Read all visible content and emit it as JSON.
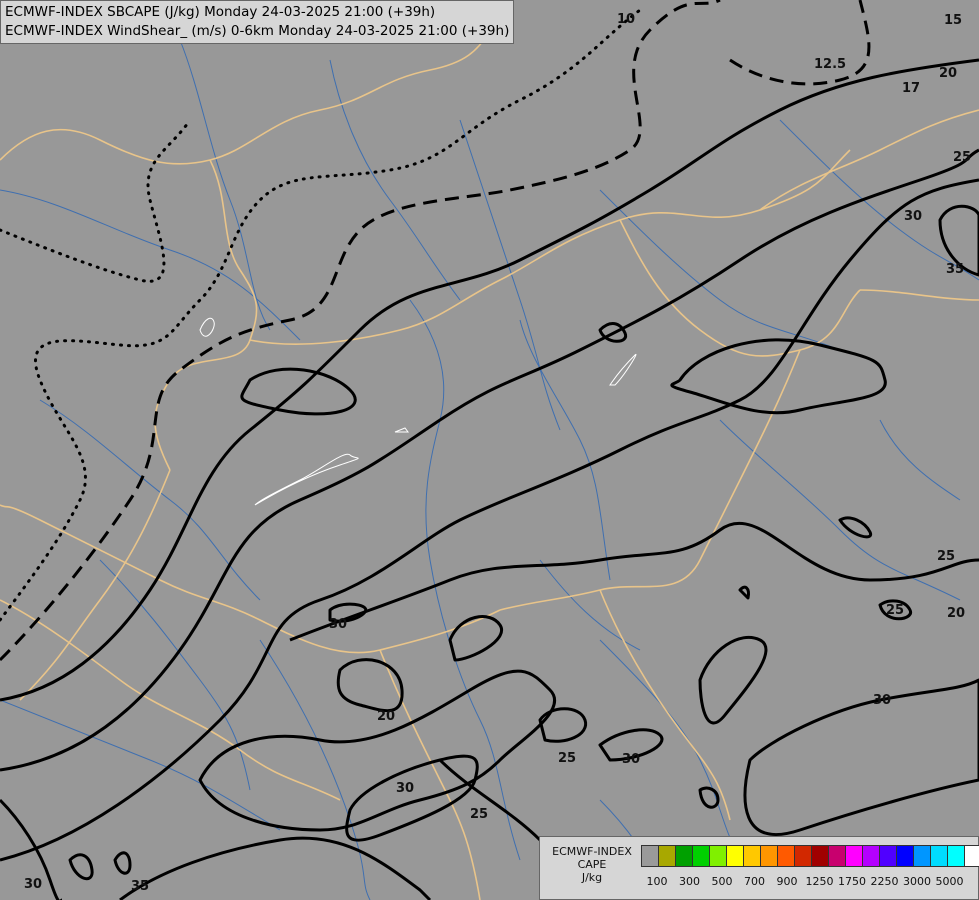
{
  "title": {
    "line1": "ECMWF-INDEX SBCAPE (J/kg) Monday 24-03-2025 21:00 (+39h)",
    "line2": "ECMWF-INDEX WindShear_ (m/s) 0-6km Monday 24-03-2025 21:00 (+39h)"
  },
  "legend": {
    "line1": "ECMWF-INDEX",
    "line2": "CAPE",
    "line3": "J/kg",
    "colors": [
      "#9a9a9a",
      "#a8a800",
      "#00a000",
      "#00d000",
      "#80f000",
      "#ffff00",
      "#ffc800",
      "#ff9600",
      "#ff5a00",
      "#d22800",
      "#a00000",
      "#c8006e",
      "#ff00ff",
      "#b400ff",
      "#5000ff",
      "#0000ff",
      "#0096ff",
      "#00dcff",
      "#00ffff",
      "#ffffff"
    ],
    "ticks": [
      "100",
      "300",
      "500",
      "700",
      "900",
      "1250",
      "1750",
      "2250",
      "3000",
      "5000"
    ]
  },
  "contour_labels": [
    {
      "text": "10"
    },
    {
      "text": "12.5"
    },
    {
      "text": "15"
    },
    {
      "text": "17"
    },
    {
      "text": "20"
    },
    {
      "text": "25"
    },
    {
      "text": "30"
    },
    {
      "text": "35"
    },
    {
      "text": "30"
    },
    {
      "text": "20"
    },
    {
      "text": "25"
    },
    {
      "text": "30"
    },
    {
      "text": "30"
    },
    {
      "text": "25"
    },
    {
      "text": "30"
    },
    {
      "text": "35"
    },
    {
      "text": "25"
    },
    {
      "text": "25"
    },
    {
      "text": "20"
    },
    {
      "text": "30"
    }
  ]
}
